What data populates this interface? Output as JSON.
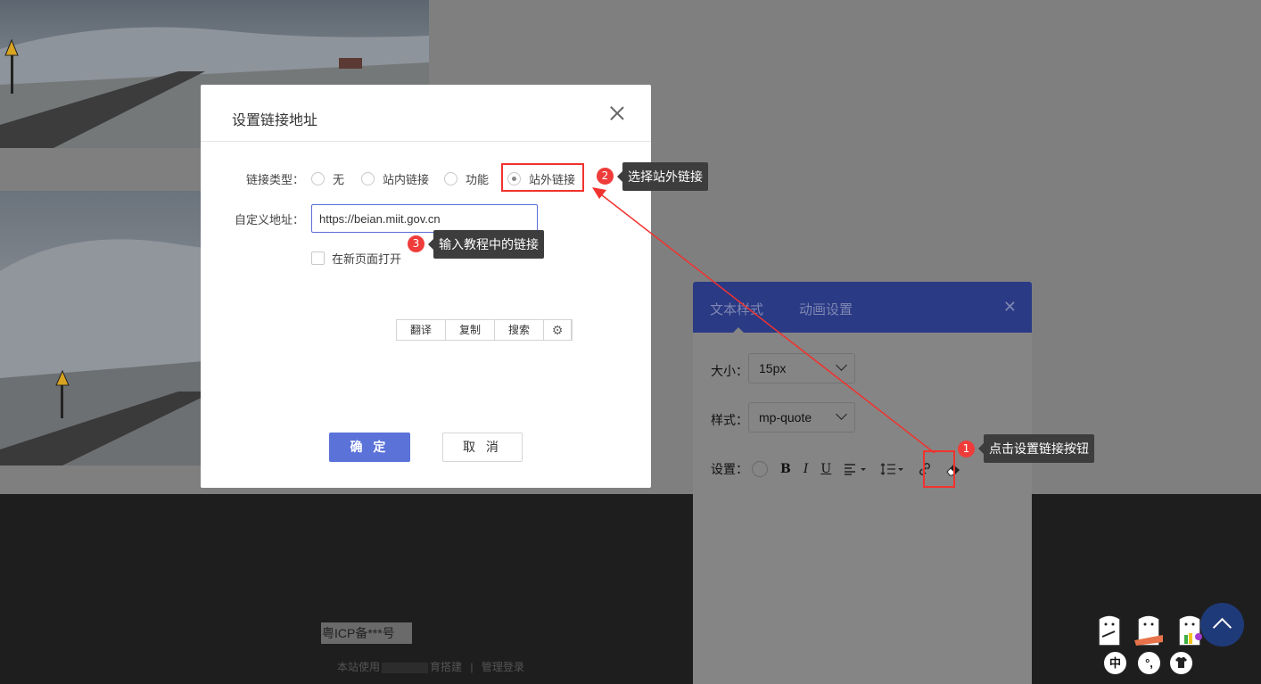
{
  "dialog": {
    "title": "设置链接地址",
    "link_type_label": "链接类型：",
    "radio_options": [
      "无",
      "站内链接",
      "功能",
      "站外链接"
    ],
    "selected_option": "站外链接",
    "custom_address_label": "自定义地址：",
    "url_value": "https://beian.miit.gov.cn",
    "new_page_label": "在新页面打开",
    "mini_toolbar": [
      "翻译",
      "复制",
      "搜索"
    ],
    "ok_label": "确 定",
    "cancel_label": "取 消"
  },
  "style_panel": {
    "tabs": [
      "文本样式",
      "动画设置"
    ],
    "size_label": "大小：",
    "size_value": "15px",
    "style_label": "样式：",
    "style_value": "mp-quote",
    "settings_label": "设置：",
    "tools": {
      "bold": "B",
      "italic": "I",
      "underline": "U"
    }
  },
  "annotations": [
    {
      "num": "1",
      "text": "点击设置链接按钮"
    },
    {
      "num": "2",
      "text": "选择站外链接"
    },
    {
      "num": "3",
      "text": "输入教程中的链接"
    }
  ],
  "footer": {
    "icp": "粤ICP备***号",
    "site_prefix": "本站使用",
    "site_suffix": "育搭建",
    "admin_login": "管理登录",
    "separator": "|"
  },
  "floating": {
    "lang_button": "中",
    "punct_button": "°,"
  },
  "colors": {
    "accent": "#5b72d9",
    "annotation_red": "#ef3c3a",
    "tooltip_bg": "#3d3d3d",
    "panel_header": "#2a3a85"
  },
  "icons": [
    "close-icon",
    "link-icon",
    "eraser-icon",
    "align-icon",
    "line-height-icon",
    "gear-icon",
    "chevron-up-icon",
    "chevron-down-icon"
  ]
}
